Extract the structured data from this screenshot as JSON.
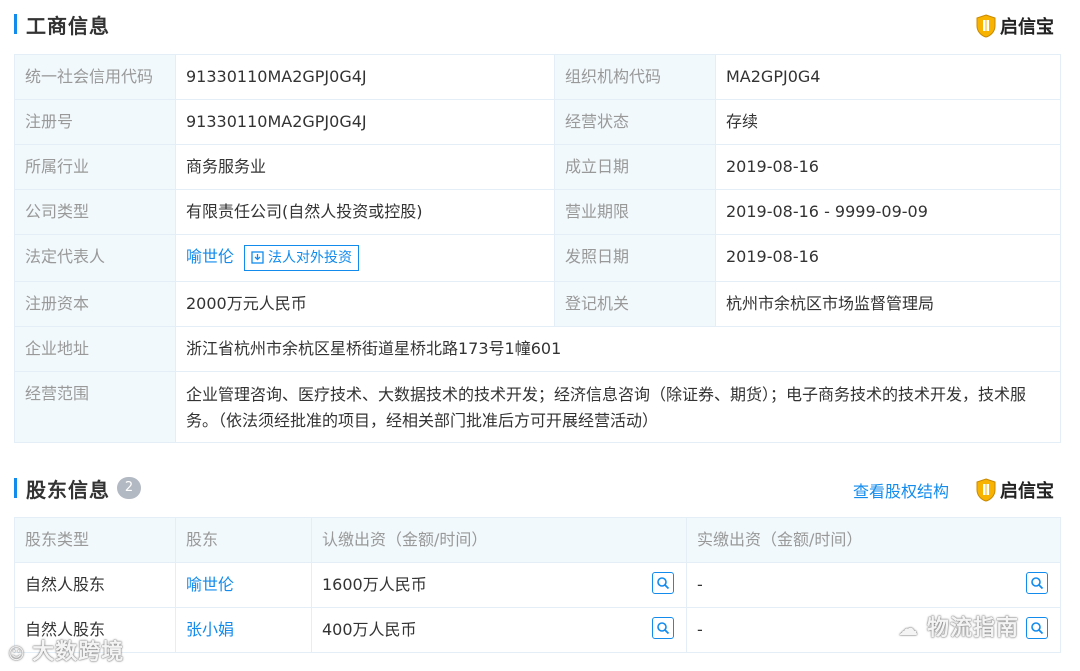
{
  "business_info": {
    "title": "工商信息",
    "brand": "启信宝",
    "rows": [
      {
        "label1": "统一社会信用代码",
        "value1": "91330110MA2GPJ0G4J",
        "label2": "组织机构代码",
        "value2": "MA2GPJ0G4"
      },
      {
        "label1": "注册号",
        "value1": "91330110MA2GPJ0G4J",
        "label2": "经营状态",
        "value2": "存续"
      },
      {
        "label1": "所属行业",
        "value1": "商务服务业",
        "label2": "成立日期",
        "value2": "2019-08-16"
      },
      {
        "label1": "公司类型",
        "value1": "有限责任公司(自然人投资或控股)",
        "label2": "营业期限",
        "value2": "2019-08-16 - 9999-09-09"
      },
      {
        "label1": "法定代表人",
        "value1": "喻世伦",
        "value1_tag": "法人对外投资",
        "label2": "发照日期",
        "value2": "2019-08-16"
      },
      {
        "label1": "注册资本",
        "value1": "2000万元人民币",
        "label2": "登记机关",
        "value2": "杭州市余杭区市场监督管理局"
      }
    ],
    "address_label": "企业地址",
    "address_value": "浙江省杭州市余杭区星桥街道星桥北路173号1幢601",
    "scope_label": "经营范围",
    "scope_value": "企业管理咨询、医疗技术、大数据技术的技术开发；经济信息咨询（除证券、期货）；电子商务技术的技术开发，技术服务。（依法须经批准的项目，经相关部门批准后方可开展经营活动）"
  },
  "shareholders": {
    "title": "股东信息",
    "count": "2",
    "equity_link": "查看股权结构",
    "brand": "启信宝",
    "headers": [
      "股东类型",
      "股东",
      "认缴出资（金额/时间）",
      "实缴出资（金额/时间）"
    ],
    "rows": [
      {
        "type": "自然人股东",
        "name": "喻世伦",
        "subscribed": "1600万人民币",
        "paid": "-"
      },
      {
        "type": "自然人股东",
        "name": "张小娟",
        "subscribed": "400万人民币",
        "paid": "-"
      }
    ]
  },
  "watermarks": {
    "left": "大数跨境",
    "right": "物流指南"
  },
  "colors": {
    "accent": "#128bed",
    "label_bg": "#f2f9fc",
    "border": "#e4eef6",
    "label_text": "#999999"
  }
}
